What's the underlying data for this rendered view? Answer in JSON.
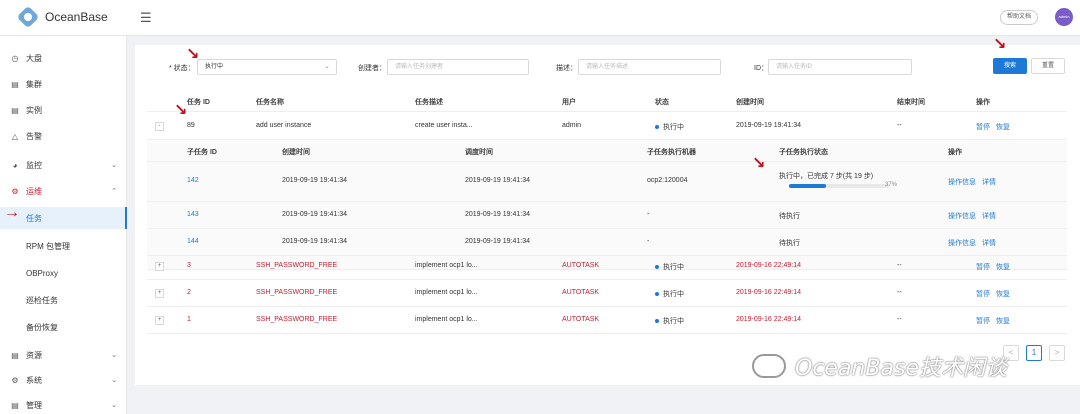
{
  "header": {
    "logo": "OceanBase",
    "help": "帮助文档",
    "avatar": "admin"
  },
  "sidebar": {
    "items": [
      {
        "label": "大盘",
        "icon": "clock-icon"
      },
      {
        "label": "集群",
        "icon": "cluster-icon"
      },
      {
        "label": "实例",
        "icon": "instance-icon"
      },
      {
        "label": "告警",
        "icon": "bell-icon"
      },
      {
        "label": "监控",
        "icon": "dashboard-icon"
      },
      {
        "label": "运维",
        "icon": "wrench-icon"
      },
      {
        "label": "任务"
      },
      {
        "label": "RPM 包管理"
      },
      {
        "label": "OBProxy"
      },
      {
        "label": "巡检任务"
      },
      {
        "label": "备份恢复"
      },
      {
        "label": "资源",
        "icon": "resource-icon"
      },
      {
        "label": "系统",
        "icon": "gear-icon"
      },
      {
        "label": "管理",
        "icon": "manage-icon"
      }
    ]
  },
  "filters": {
    "status_label": "* 状态：",
    "status_value": "执行中",
    "creator_label": "创建者：",
    "creator_placeholder": "请输入任务创建者",
    "desc_label": "描述：",
    "desc_placeholder": "请输入任务描述",
    "id_label": "ID：",
    "id_placeholder": "请输入任务ID",
    "search": "搜索",
    "reset": "重置"
  },
  "table": {
    "headers": [
      "任务 ID",
      "任务名称",
      "任务描述",
      "用户",
      "状态",
      "创建时间",
      "结束时间",
      "操作"
    ],
    "rows": [
      {
        "expander": "-",
        "id": "89",
        "name": "add user instance",
        "desc": "create user insta...",
        "user": "admin",
        "status": "执行中",
        "created": "2019-09-19 19:41:34",
        "ended": "--",
        "a1": "暂停",
        "a2": "恢复"
      },
      {
        "expander": "+",
        "id": "3",
        "name": "SSH_PASSWORD_FREE",
        "desc": "implement ocp1 lo...",
        "user": "AUTOTASK",
        "status": "执行中",
        "created": "2019-09-16 22:49:14",
        "ended": "--",
        "a1": "暂停",
        "a2": "恢复"
      },
      {
        "expander": "+",
        "id": "2",
        "name": "SSH_PASSWORD_FREE",
        "desc": "implement ocp1 lo...",
        "user": "AUTOTASK",
        "status": "执行中",
        "created": "2019-09-16 22:49:14",
        "ended": "--",
        "a1": "暂停",
        "a2": "恢复"
      },
      {
        "expander": "+",
        "id": "1",
        "name": "SSH_PASSWORD_FREE",
        "desc": "implement ocp1 lo...",
        "user": "AUTOTASK",
        "status": "执行中",
        "created": "2019-09-16 22:49:14",
        "ended": "--",
        "a1": "暂停",
        "a2": "恢复"
      }
    ]
  },
  "subtable": {
    "headers": [
      "子任务 ID",
      "创建时间",
      "调度时间",
      "子任务执行机器",
      "子任务执行状态",
      "操作"
    ],
    "rows": [
      {
        "id": "142",
        "created": "2019-09-19 19:41:34",
        "scheduled": "2019-09-19 19:41:34",
        "machine": "ocp2:120004",
        "state": "执行中，已完成 7 步(共 19 步)",
        "progress": 37,
        "progress_text": "37%",
        "a1": "操作信息",
        "a2": "详情"
      },
      {
        "id": "143",
        "created": "2019-09-19 19:41:34",
        "scheduled": "2019-09-19 19:41:34",
        "machine": "-",
        "state": "待执行",
        "a1": "操作信息",
        "a2": "详情"
      },
      {
        "id": "144",
        "created": "2019-09-19 19:41:34",
        "scheduled": "2019-09-19 19:41:34",
        "machine": "-",
        "state": "待执行",
        "a1": "操作信息",
        "a2": "详情"
      }
    ]
  },
  "pager": {
    "prev": "<",
    "current": "1",
    "next": ">"
  },
  "watermark": "OceanBase技术闲谈",
  "colors": {
    "primary": "#1e78d7",
    "danger": "#c41d2f",
    "annotation": "#c0121b"
  }
}
